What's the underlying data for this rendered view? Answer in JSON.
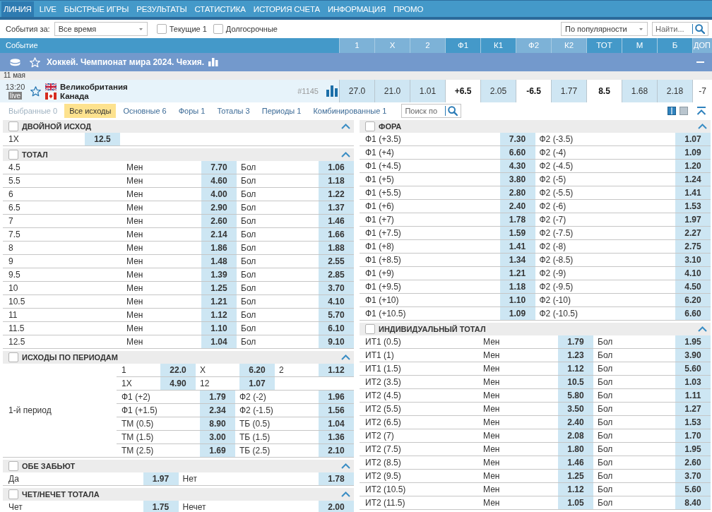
{
  "nav": {
    "tabs": [
      {
        "label": "ЛИНИЯ",
        "selected": true
      },
      {
        "label": "LIVE",
        "selected": false
      },
      {
        "label": "БЫСТРЫЕ ИГРЫ",
        "selected": false
      },
      {
        "label": "РЕЗУЛЬТАТЫ",
        "selected": false
      },
      {
        "label": "СТАТИСТИКА",
        "selected": false
      },
      {
        "label": "ИСТОРИЯ СЧЕТА",
        "selected": false
      },
      {
        "label": "ИНФОРМАЦИЯ",
        "selected": false
      },
      {
        "label": "ПРОМО",
        "selected": false
      }
    ]
  },
  "filters": {
    "period_label": "События за:",
    "period": "Все время",
    "checkboxes": [
      {
        "label": "Текущие 1",
        "checked": false
      },
      {
        "label": "Долгосрочные",
        "checked": false
      }
    ],
    "sort": "По популярности",
    "search": {
      "placeholder": "Найти..."
    }
  },
  "table": {
    "event_header": "Событие",
    "columns": [
      {
        "label": "1",
        "highlighted": false
      },
      {
        "label": "X",
        "highlighted": false
      },
      {
        "label": "2",
        "highlighted": false
      },
      {
        "label": "Ф1",
        "highlighted": true
      },
      {
        "label": "К1",
        "highlighted": true
      },
      {
        "label": "Ф2",
        "highlighted": false
      },
      {
        "label": "К2",
        "highlighted": false
      },
      {
        "label": "ТОТ",
        "highlighted": true
      },
      {
        "label": "М",
        "highlighted": true
      },
      {
        "label": "Б",
        "highlighted": true
      },
      {
        "label": "ДОП",
        "highlighted": false
      }
    ]
  },
  "tournament": {
    "title": "Хоккей. Чемпионат мира 2024. Чехия."
  },
  "date": "11 мая",
  "event": {
    "time": "13:20",
    "badge": "live",
    "teams": [
      "Великобритания",
      "Канада"
    ],
    "number": "#1145",
    "cells": [
      {
        "value": "27.0",
        "kind": "odds"
      },
      {
        "value": "21.0",
        "kind": "odds"
      },
      {
        "value": "1.01",
        "kind": "odds"
      },
      {
        "value": "+6.5",
        "kind": "param"
      },
      {
        "value": "2.05",
        "kind": "odds"
      },
      {
        "value": "-6.5",
        "kind": "param"
      },
      {
        "value": "1.77",
        "kind": "odds"
      },
      {
        "value": "8.5",
        "kind": "param"
      },
      {
        "value": "1.68",
        "kind": "odds"
      },
      {
        "value": "2.18",
        "kind": "odds"
      },
      {
        "value": "-7",
        "kind": "extra"
      }
    ]
  },
  "market_tabs": [
    {
      "label": "Выбранные 0",
      "selected": false,
      "disabled": true
    },
    {
      "label": "Все исходы",
      "selected": true,
      "disabled": false
    },
    {
      "label": "Основные 6",
      "selected": false,
      "disabled": false
    },
    {
      "label": "Форы 1",
      "selected": false,
      "disabled": false
    },
    {
      "label": "Тоталы 3",
      "selected": false,
      "disabled": false
    },
    {
      "label": "Периоды 1",
      "selected": false,
      "disabled": false
    },
    {
      "label": "Комбинированные 1",
      "selected": false,
      "disabled": false
    }
  ],
  "market_search": {
    "placeholder": "Поиск по"
  },
  "views": [
    {
      "kind": "two-column",
      "selected": true
    },
    {
      "kind": "one-column",
      "selected": false
    }
  ],
  "market_columns": [
    {
      "markets": [
        {
          "title": "ДВОЙНОЙ ИСХОД",
          "checked": false,
          "expanded": true,
          "kind": "single",
          "rows": [
            {
              "outcomes": [
                {
                  "label": "1X",
                  "odds": "12.5"
                }
              ]
            }
          ]
        },
        {
          "title": "ТОТАЛ",
          "checked": false,
          "expanded": true,
          "kind": "total",
          "rows": [
            {
              "line": "4.5",
              "outcomes": [
                {
                  "label": "Мен",
                  "odds": "7.70"
                },
                {
                  "label": "Бол",
                  "odds": "1.06"
                }
              ]
            },
            {
              "line": "5.5",
              "outcomes": [
                {
                  "label": "Мен",
                  "odds": "4.60"
                },
                {
                  "label": "Бол",
                  "odds": "1.18"
                }
              ]
            },
            {
              "line": "6",
              "outcomes": [
                {
                  "label": "Мен",
                  "odds": "4.00"
                },
                {
                  "label": "Бол",
                  "odds": "1.22"
                }
              ]
            },
            {
              "line": "6.5",
              "outcomes": [
                {
                  "label": "Мен",
                  "odds": "2.90"
                },
                {
                  "label": "Бол",
                  "odds": "1.37"
                }
              ]
            },
            {
              "line": "7",
              "outcomes": [
                {
                  "label": "Мен",
                  "odds": "2.60"
                },
                {
                  "label": "Бол",
                  "odds": "1.46"
                }
              ]
            },
            {
              "line": "7.5",
              "outcomes": [
                {
                  "label": "Мен",
                  "odds": "2.14"
                },
                {
                  "label": "Бол",
                  "odds": "1.66"
                }
              ]
            },
            {
              "line": "8",
              "outcomes": [
                {
                  "label": "Мен",
                  "odds": "1.86"
                },
                {
                  "label": "Бол",
                  "odds": "1.88"
                }
              ]
            },
            {
              "line": "9",
              "outcomes": [
                {
                  "label": "Мен",
                  "odds": "1.48"
                },
                {
                  "label": "Бол",
                  "odds": "2.55"
                }
              ]
            },
            {
              "line": "9.5",
              "outcomes": [
                {
                  "label": "Мен",
                  "odds": "1.39"
                },
                {
                  "label": "Бол",
                  "odds": "2.85"
                }
              ]
            },
            {
              "line": "10",
              "outcomes": [
                {
                  "label": "Мен",
                  "odds": "1.25"
                },
                {
                  "label": "Бол",
                  "odds": "3.70"
                }
              ]
            },
            {
              "line": "10.5",
              "outcomes": [
                {
                  "label": "Мен",
                  "odds": "1.21"
                },
                {
                  "label": "Бол",
                  "odds": "4.10"
                }
              ]
            },
            {
              "line": "11",
              "outcomes": [
                {
                  "label": "Мен",
                  "odds": "1.12"
                },
                {
                  "label": "Бол",
                  "odds": "5.70"
                }
              ]
            },
            {
              "line": "11.5",
              "outcomes": [
                {
                  "label": "Мен",
                  "odds": "1.10"
                },
                {
                  "label": "Бол",
                  "odds": "6.10"
                }
              ]
            },
            {
              "line": "12.5",
              "outcomes": [
                {
                  "label": "Мен",
                  "odds": "1.04"
                },
                {
                  "label": "Бол",
                  "odds": "9.10"
                }
              ]
            }
          ]
        },
        {
          "title": "ИСХОДЫ ПО ПЕРИОДАМ",
          "checked": false,
          "expanded": true,
          "kind": "periods",
          "periods": [
            {
              "name": "1-й период",
              "rows": [
                {
                  "kind": "three-way",
                  "outcomes": [
                    {
                      "label": "1",
                      "odds": "22.0"
                    },
                    {
                      "label": "X",
                      "odds": "6.20"
                    },
                    {
                      "label": "2",
                      "odds": "1.12"
                    }
                  ]
                },
                {
                  "kind": "three-way",
                  "outcomes": [
                    {
                      "label": "1X",
                      "odds": "4.90"
                    },
                    {
                      "label": "12",
                      "odds": "1.07"
                    }
                  ]
                },
                {
                  "kind": "two-way",
                  "outcomes": [
                    {
                      "label": "Ф1 (+2)",
                      "odds": "1.79"
                    },
                    {
                      "label": "Ф2 (-2)",
                      "odds": "1.96"
                    }
                  ]
                },
                {
                  "kind": "two-way",
                  "outcomes": [
                    {
                      "label": "Ф1 (+1.5)",
                      "odds": "2.34"
                    },
                    {
                      "label": "Ф2 (-1.5)",
                      "odds": "1.56"
                    }
                  ]
                },
                {
                  "kind": "two-way",
                  "outcomes": [
                    {
                      "label": "ТМ (0.5)",
                      "odds": "8.90"
                    },
                    {
                      "label": "ТБ (0.5)",
                      "odds": "1.04"
                    }
                  ]
                },
                {
                  "kind": "two-way",
                  "outcomes": [
                    {
                      "label": "ТМ (1.5)",
                      "odds": "3.00"
                    },
                    {
                      "label": "ТБ (1.5)",
                      "odds": "1.36"
                    }
                  ]
                },
                {
                  "kind": "two-way",
                  "outcomes": [
                    {
                      "label": "ТМ (2.5)",
                      "odds": "1.69"
                    },
                    {
                      "label": "ТБ (2.5)",
                      "odds": "2.10"
                    }
                  ]
                }
              ]
            }
          ]
        },
        {
          "title": "ОБЕ ЗАБЬЮТ",
          "checked": false,
          "expanded": true,
          "kind": "pair",
          "rows": [
            {
              "outcomes": [
                {
                  "label": "Да",
                  "odds": "1.97"
                },
                {
                  "label": "Нет",
                  "odds": "1.78"
                }
              ]
            }
          ]
        },
        {
          "title": "ЧЕТ/НЕЧЕТ ТОТАЛА",
          "checked": false,
          "expanded": true,
          "kind": "pair",
          "rows": [
            {
              "outcomes": [
                {
                  "label": "Чет",
                  "odds": "1.75"
                },
                {
                  "label": "Нечет",
                  "odds": "2.00"
                }
              ]
            }
          ]
        }
      ]
    },
    {
      "markets": [
        {
          "title": "ФОРА",
          "checked": false,
          "expanded": true,
          "kind": "pair",
          "rows": [
            {
              "outcomes": [
                {
                  "label": "Ф1 (+3.5)",
                  "odds": "7.30"
                },
                {
                  "label": "Ф2 (-3.5)",
                  "odds": "1.07"
                }
              ]
            },
            {
              "outcomes": [
                {
                  "label": "Ф1 (+4)",
                  "odds": "6.60"
                },
                {
                  "label": "Ф2 (-4)",
                  "odds": "1.09"
                }
              ]
            },
            {
              "outcomes": [
                {
                  "label": "Ф1 (+4.5)",
                  "odds": "4.30"
                },
                {
                  "label": "Ф2 (-4.5)",
                  "odds": "1.20"
                }
              ]
            },
            {
              "outcomes": [
                {
                  "label": "Ф1 (+5)",
                  "odds": "3.80"
                },
                {
                  "label": "Ф2 (-5)",
                  "odds": "1.24"
                }
              ]
            },
            {
              "outcomes": [
                {
                  "label": "Ф1 (+5.5)",
                  "odds": "2.80"
                },
                {
                  "label": "Ф2 (-5.5)",
                  "odds": "1.41"
                }
              ]
            },
            {
              "outcomes": [
                {
                  "label": "Ф1 (+6)",
                  "odds": "2.40"
                },
                {
                  "label": "Ф2 (-6)",
                  "odds": "1.53"
                }
              ]
            },
            {
              "outcomes": [
                {
                  "label": "Ф1 (+7)",
                  "odds": "1.78"
                },
                {
                  "label": "Ф2 (-7)",
                  "odds": "1.97"
                }
              ]
            },
            {
              "outcomes": [
                {
                  "label": "Ф1 (+7.5)",
                  "odds": "1.59"
                },
                {
                  "label": "Ф2 (-7.5)",
                  "odds": "2.27"
                }
              ]
            },
            {
              "outcomes": [
                {
                  "label": "Ф1 (+8)",
                  "odds": "1.41"
                },
                {
                  "label": "Ф2 (-8)",
                  "odds": "2.75"
                }
              ]
            },
            {
              "outcomes": [
                {
                  "label": "Ф1 (+8.5)",
                  "odds": "1.34"
                },
                {
                  "label": "Ф2 (-8.5)",
                  "odds": "3.10"
                }
              ]
            },
            {
              "outcomes": [
                {
                  "label": "Ф1 (+9)",
                  "odds": "1.21"
                },
                {
                  "label": "Ф2 (-9)",
                  "odds": "4.10"
                }
              ]
            },
            {
              "outcomes": [
                {
                  "label": "Ф1 (+9.5)",
                  "odds": "1.18"
                },
                {
                  "label": "Ф2 (-9.5)",
                  "odds": "4.50"
                }
              ]
            },
            {
              "outcomes": [
                {
                  "label": "Ф1 (+10)",
                  "odds": "1.10"
                },
                {
                  "label": "Ф2 (-10)",
                  "odds": "6.20"
                }
              ]
            },
            {
              "outcomes": [
                {
                  "label": "Ф1 (+10.5)",
                  "odds": "1.09"
                },
                {
                  "label": "Ф2 (-10.5)",
                  "odds": "6.60"
                }
              ]
            }
          ]
        },
        {
          "title": "ИНДИВИДУАЛЬНЫЙ ТОТАЛ",
          "checked": false,
          "expanded": true,
          "kind": "total",
          "rows": [
            {
              "line": "ИТ1 (0.5)",
              "outcomes": [
                {
                  "label": "Мен",
                  "odds": "1.79"
                },
                {
                  "label": "Бол",
                  "odds": "1.95"
                }
              ]
            },
            {
              "line": "ИТ1 (1)",
              "outcomes": [
                {
                  "label": "Мен",
                  "odds": "1.23"
                },
                {
                  "label": "Бол",
                  "odds": "3.90"
                }
              ]
            },
            {
              "line": "ИТ1 (1.5)",
              "outcomes": [
                {
                  "label": "Мен",
                  "odds": "1.12"
                },
                {
                  "label": "Бол",
                  "odds": "5.60"
                }
              ]
            },
            {
              "line": "ИТ2 (3.5)",
              "outcomes": [
                {
                  "label": "Мен",
                  "odds": "10.5"
                },
                {
                  "label": "Бол",
                  "odds": "1.03"
                }
              ]
            },
            {
              "line": "ИТ2 (4.5)",
              "outcomes": [
                {
                  "label": "Мен",
                  "odds": "5.80"
                },
                {
                  "label": "Бол",
                  "odds": "1.11"
                }
              ]
            },
            {
              "line": "ИТ2 (5.5)",
              "outcomes": [
                {
                  "label": "Мен",
                  "odds": "3.50"
                },
                {
                  "label": "Бол",
                  "odds": "1.27"
                }
              ]
            },
            {
              "line": "ИТ2 (6.5)",
              "outcomes": [
                {
                  "label": "Мен",
                  "odds": "2.40"
                },
                {
                  "label": "Бол",
                  "odds": "1.53"
                }
              ]
            },
            {
              "line": "ИТ2 (7)",
              "outcomes": [
                {
                  "label": "Мен",
                  "odds": "2.08"
                },
                {
                  "label": "Бол",
                  "odds": "1.70"
                }
              ]
            },
            {
              "line": "ИТ2 (7.5)",
              "outcomes": [
                {
                  "label": "Мен",
                  "odds": "1.80"
                },
                {
                  "label": "Бол",
                  "odds": "1.95"
                }
              ]
            },
            {
              "line": "ИТ2 (8.5)",
              "outcomes": [
                {
                  "label": "Мен",
                  "odds": "1.46"
                },
                {
                  "label": "Бол",
                  "odds": "2.60"
                }
              ]
            },
            {
              "line": "ИТ2 (9.5)",
              "outcomes": [
                {
                  "label": "Мен",
                  "odds": "1.25"
                },
                {
                  "label": "Бол",
                  "odds": "3.70"
                }
              ]
            },
            {
              "line": "ИТ2 (10.5)",
              "outcomes": [
                {
                  "label": "Мен",
                  "odds": "1.12"
                },
                {
                  "label": "Бол",
                  "odds": "5.60"
                }
              ]
            },
            {
              "line": "ИТ2 (11.5)",
              "outcomes": [
                {
                  "label": "Мен",
                  "odds": "1.05"
                },
                {
                  "label": "Бол",
                  "odds": "8.40"
                }
              ]
            }
          ]
        }
      ]
    }
  ]
}
